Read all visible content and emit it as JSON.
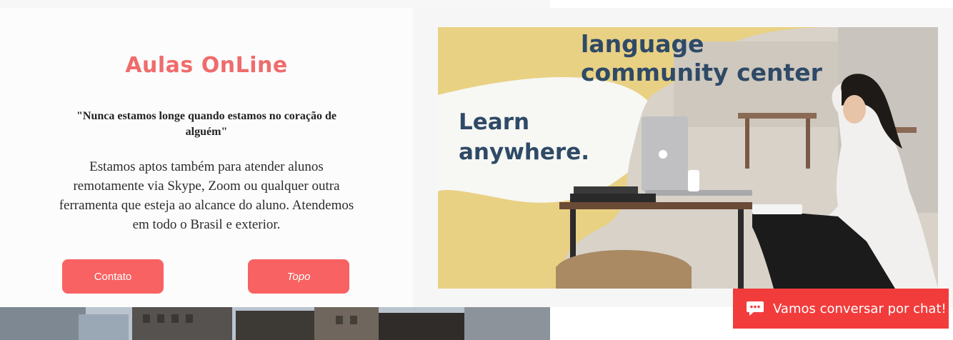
{
  "section": {
    "title": "Aulas OnLine",
    "quote": "\"Nunca estamos longe quando estamos no coração de alguém\"",
    "description": "Estamos aptos também para atender alunos remotamente via Skype, Zoom ou qualquer outra ferramenta que esteja ao alcance do aluno. Atendemos em todo o Brasil e exterior.",
    "buttons": {
      "contact_label": "Contato",
      "top_label": "Topo"
    }
  },
  "promo_image": {
    "heading_line1": "language",
    "heading_line2": "community center",
    "tagline_line1": "Learn",
    "tagline_line2": "anywhere."
  },
  "chat_widget": {
    "label": "Vamos conversar por chat!",
    "icon": "chat-bubble-icon"
  },
  "colors": {
    "accent": "#f86262",
    "title": "#ef6c6c",
    "chat": "#f23c3c",
    "promo_text": "#2f4a66",
    "promo_bg": "#e9d184"
  }
}
